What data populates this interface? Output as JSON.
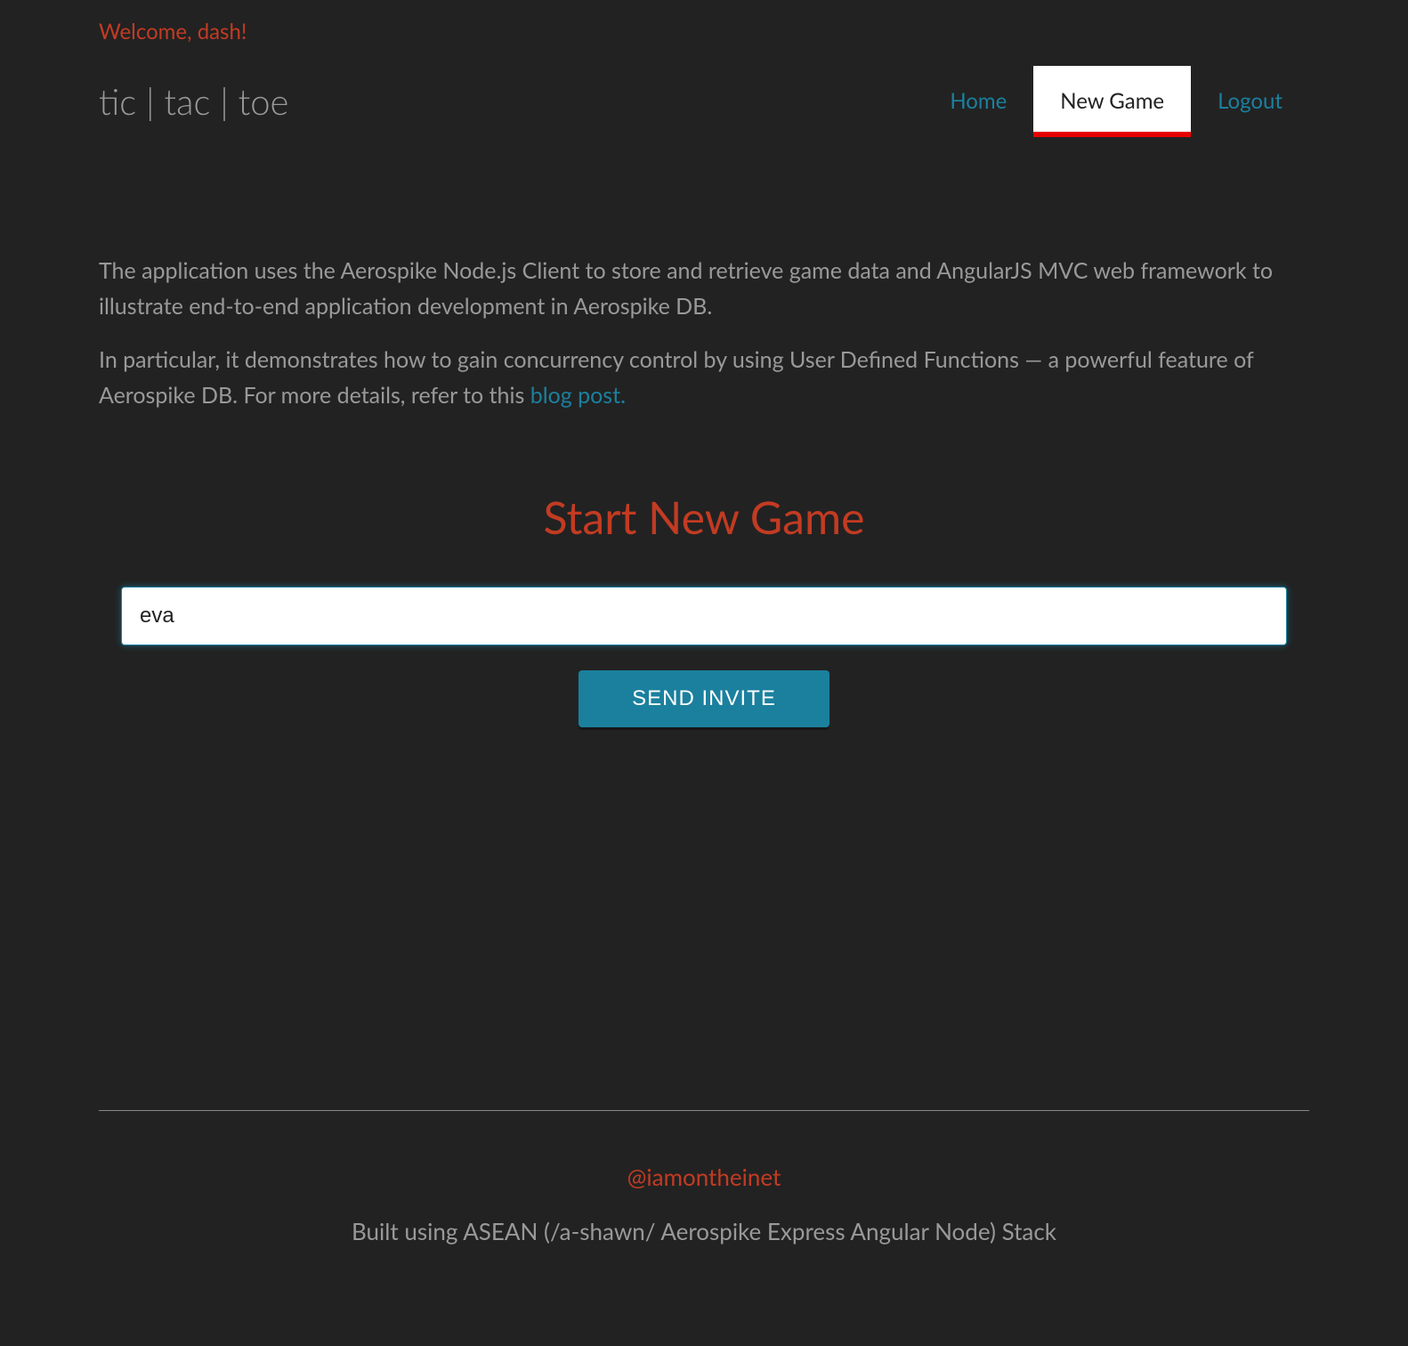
{
  "header": {
    "welcome": "Welcome, dash!",
    "logo": "tic | tac | toe",
    "nav": {
      "home": "Home",
      "new_game": "New Game",
      "logout": "Logout"
    }
  },
  "content": {
    "description1": "The application uses the Aerospike Node.js Client to store and retrieve game data and AngularJS MVC web framework to illustrate end-to-end application development in Aerospike DB.",
    "description2_prefix": "In particular, it demonstrates how to gain concurrency control by using User Defined Functions — a powerful feature of Aerospike DB. For more details, refer to this ",
    "description2_link": "blog post.",
    "section_title": "Start New Game",
    "form": {
      "input_value": "eva",
      "button_label": "SEND INVITE"
    }
  },
  "footer": {
    "handle": "@iamontheinet",
    "stack_text": "Built using ASEAN (/a-shawn/ Aerospike Express Angular Node) Stack"
  }
}
